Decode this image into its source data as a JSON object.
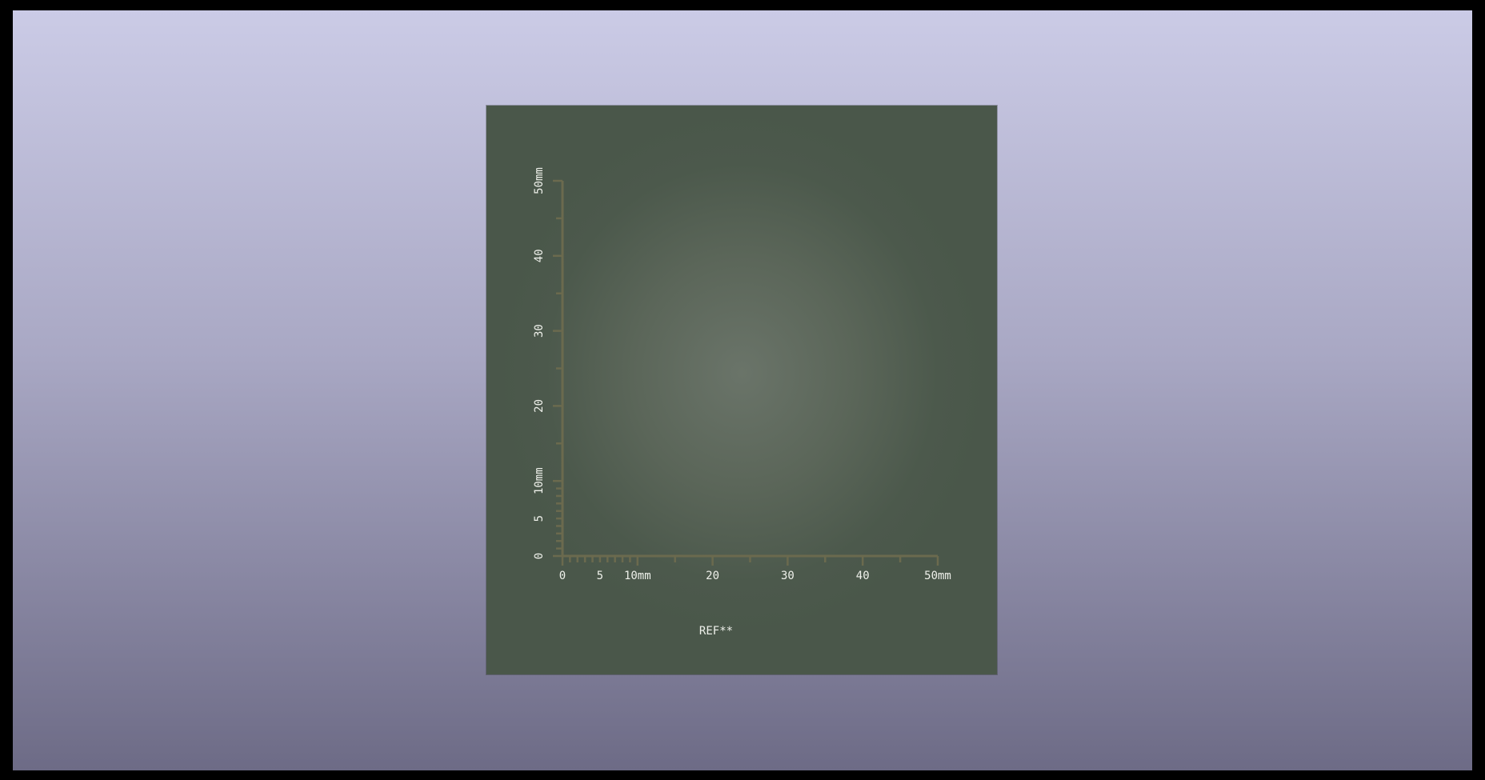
{
  "scene": {
    "background_top": "#cbcbe6",
    "background_bottom": "#6d6b86",
    "board_color": "#4a574a",
    "ruler_color": "#6b6a4e",
    "text_color": "#eef0ea"
  },
  "ruler": {
    "unit": "mm",
    "range_mm": [
      0,
      50
    ],
    "x_labels": [
      {
        "value_mm": 0,
        "text": "0"
      },
      {
        "value_mm": 5,
        "text": "5"
      },
      {
        "value_mm": 10,
        "text": "10mm"
      },
      {
        "value_mm": 20,
        "text": "20"
      },
      {
        "value_mm": 30,
        "text": "30"
      },
      {
        "value_mm": 40,
        "text": "40"
      },
      {
        "value_mm": 50,
        "text": "50mm"
      }
    ],
    "y_labels": [
      {
        "value_mm": 0,
        "text": "0"
      },
      {
        "value_mm": 5,
        "text": "5"
      },
      {
        "value_mm": 10,
        "text": "10mm"
      },
      {
        "value_mm": 20,
        "text": "20"
      },
      {
        "value_mm": 30,
        "text": "30"
      },
      {
        "value_mm": 40,
        "text": "40"
      },
      {
        "value_mm": 50,
        "text": "50mm"
      }
    ]
  },
  "footprint": {
    "reference": "REF**"
  }
}
